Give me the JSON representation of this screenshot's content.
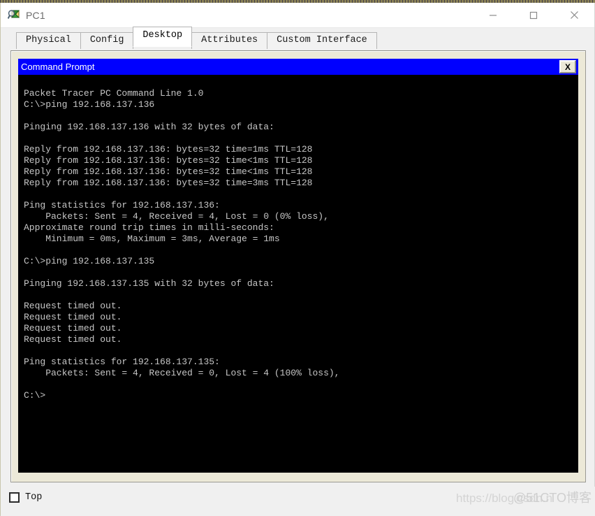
{
  "window": {
    "title": "PC1",
    "icon": "packet-tracer-pc-icon",
    "controls": {
      "minimize": "—",
      "maximize": "☐",
      "close": "✕"
    }
  },
  "tabs": [
    {
      "label": "Physical",
      "active": false
    },
    {
      "label": "Config",
      "active": false
    },
    {
      "label": "Desktop",
      "active": true
    },
    {
      "label": "Attributes",
      "active": false
    },
    {
      "label": "Custom Interface",
      "active": false
    }
  ],
  "command_prompt": {
    "title": "Command Prompt",
    "close_label": "X",
    "output": "Packet Tracer PC Command Line 1.0\nC:\\>ping 192.168.137.136\n\nPinging 192.168.137.136 with 32 bytes of data:\n\nReply from 192.168.137.136: bytes=32 time=1ms TTL=128\nReply from 192.168.137.136: bytes=32 time<1ms TTL=128\nReply from 192.168.137.136: bytes=32 time<1ms TTL=128\nReply from 192.168.137.136: bytes=32 time=3ms TTL=128\n\nPing statistics for 192.168.137.136:\n    Packets: Sent = 4, Received = 4, Lost = 0 (0% loss),\nApproximate round trip times in milli-seconds:\n    Minimum = 0ms, Maximum = 3ms, Average = 1ms\n\nC:\\>ping 192.168.137.135\n\nPinging 192.168.137.135 with 32 bytes of data:\n\nRequest timed out.\nRequest timed out.\nRequest timed out.\nRequest timed out.\n\nPing statistics for 192.168.137.135:\n    Packets: Sent = 4, Received = 0, Lost = 4 (100% loss),\n\nC:\\>"
  },
  "bottom": {
    "top_checkbox_label": "Top",
    "top_checkbox_checked": false
  },
  "watermark": {
    "line1": "https://blog.csdn.n",
    "line2": "@51CTO博客"
  },
  "colors": {
    "cmd_titlebar": "#0000ff",
    "panel": "#ece9d8",
    "terminal_bg": "#000000",
    "terminal_fg": "#c6c6c6",
    "window_bg": "#f0f0f0"
  }
}
